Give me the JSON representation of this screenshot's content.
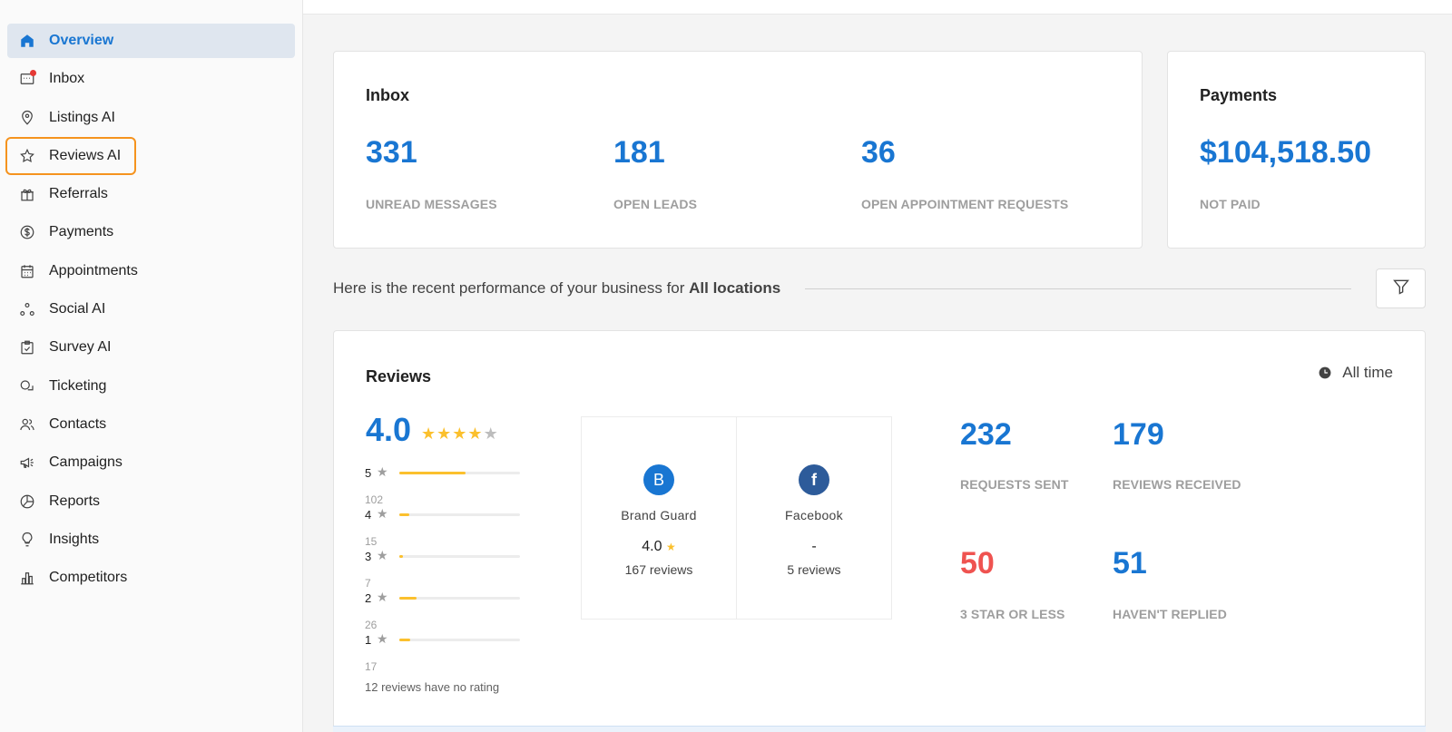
{
  "sidebar": {
    "items": [
      {
        "label": "Overview",
        "icon": "home-icon"
      },
      {
        "label": "Inbox",
        "icon": "inbox-icon"
      },
      {
        "label": "Listings AI",
        "icon": "location-pin-icon"
      },
      {
        "label": "Reviews AI",
        "icon": "star-icon"
      },
      {
        "label": "Referrals",
        "icon": "gift-icon"
      },
      {
        "label": "Payments",
        "icon": "dollar-circle-icon"
      },
      {
        "label": "Appointments",
        "icon": "calendar-icon"
      },
      {
        "label": "Social AI",
        "icon": "social-icon"
      },
      {
        "label": "Survey AI",
        "icon": "survey-icon"
      },
      {
        "label": "Ticketing",
        "icon": "chat-bubbles-icon"
      },
      {
        "label": "Contacts",
        "icon": "contacts-icon"
      },
      {
        "label": "Campaigns",
        "icon": "megaphone-icon"
      },
      {
        "label": "Reports",
        "icon": "pie-chart-icon"
      },
      {
        "label": "Insights",
        "icon": "lightbulb-icon"
      },
      {
        "label": "Competitors",
        "icon": "bar-chart-icon"
      }
    ]
  },
  "inbox_card": {
    "title": "Inbox",
    "stats": [
      {
        "value": "331",
        "label": "UNREAD MESSAGES"
      },
      {
        "value": "181",
        "label": "OPEN LEADS"
      },
      {
        "value": "36",
        "label": "OPEN APPOINTMENT REQUESTS"
      }
    ]
  },
  "payments_card": {
    "title": "Payments",
    "value": "$104,518.50",
    "label": "NOT PAID"
  },
  "performance": {
    "text": "Here is the recent performance of your business for",
    "scope": "All locations"
  },
  "reviews_card": {
    "title": "Reviews",
    "time_range": "All time",
    "average": "4.0",
    "stars_filled": 4,
    "breakdown": [
      {
        "stars": "5",
        "count": "102",
        "fraction": 0.55
      },
      {
        "stars": "4",
        "count": "15",
        "fraction": 0.08
      },
      {
        "stars": "3",
        "count": "7",
        "fraction": 0.03
      },
      {
        "stars": "2",
        "count": "26",
        "fraction": 0.14
      },
      {
        "stars": "1",
        "count": "17",
        "fraction": 0.09
      }
    ],
    "no_rating_text": "12 reviews have no rating",
    "sources": [
      {
        "name": "Brand Guard",
        "initial": "B",
        "rating": "4.0",
        "reviews": "167 reviews",
        "color": "#1976d2"
      },
      {
        "name": "Facebook",
        "initial": "f",
        "rating": "-",
        "reviews": "5 reviews",
        "color": "#2d5b9a"
      }
    ],
    "stats": [
      {
        "value": "232",
        "label": "REQUESTS SENT",
        "color": "#1976d2"
      },
      {
        "value": "179",
        "label": "REVIEWS RECEIVED",
        "color": "#1976d2"
      },
      {
        "value": "50",
        "label": "3 STAR OR LESS",
        "color": "#ef5350"
      },
      {
        "value": "51",
        "label": "HAVEN'T REPLIED",
        "color": "#1976d2"
      }
    ]
  },
  "colors": {
    "accent": "#1976d2",
    "warning": "#ef5350",
    "star": "#fbc02d",
    "highlight_outline": "#f5931e"
  }
}
